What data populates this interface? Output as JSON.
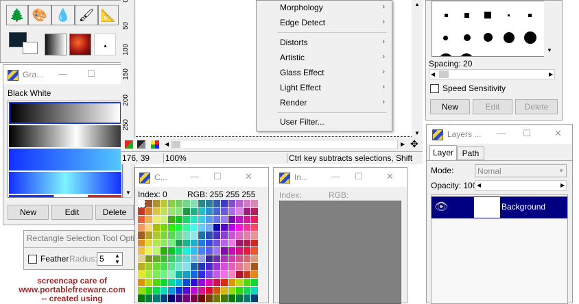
{
  "tools": {
    "icons": [
      "tree-icon",
      "palette-icon",
      "drop-icon",
      "airbrush-icon",
      "compass-icon"
    ]
  },
  "gradient_panel": {
    "title": "Gra...",
    "selected_name": "Black White",
    "buttons": {
      "new": "New",
      "edit": "Edit",
      "delete": "Delete"
    }
  },
  "canvas": {
    "ruler_labels": [
      "0",
      "50",
      "100",
      "150",
      "200",
      "250"
    ],
    "status_coords": "176, 39",
    "status_zoom": "100%",
    "status_hint": "Ctrl key subtracts selections, Shift"
  },
  "menu": {
    "items": [
      {
        "label": "Morphology",
        "submenu": true
      },
      {
        "label": "Edge Detect",
        "submenu": true
      },
      {
        "label": "Distorts",
        "submenu": true
      },
      {
        "label": "Artistic",
        "submenu": true
      },
      {
        "label": "Glass Effect",
        "submenu": true
      },
      {
        "label": "Light Effect",
        "submenu": true
      },
      {
        "label": "Render",
        "submenu": true
      },
      {
        "label": "User Filter...",
        "submenu": false
      }
    ]
  },
  "brush_panel": {
    "spacing_label": "Spacing: 20",
    "speed_sensitivity": "Speed Sensitivity",
    "buttons": {
      "new": "New",
      "edit": "Edit",
      "delete": "Delete"
    }
  },
  "colors_panel": {
    "title": "C...",
    "index_label": "Index: 0",
    "rgb_label": "RGB: 255 255 255"
  },
  "info_panel": {
    "title": "In...",
    "index_label": "Index:",
    "rgb_label": "RGB:"
  },
  "rect_options": {
    "title": "Rectangle Selection Tool Opti",
    "feather_label": "Feather",
    "radius_label": "Radius:",
    "radius_value": "5"
  },
  "layers_panel": {
    "title": "Layers ...",
    "tabs": [
      "Layer",
      "Path"
    ],
    "mode_label": "Mode:",
    "mode_value": "Nomal",
    "opacity_label": "Opacity: 100",
    "layer_name": "Background"
  },
  "watermark": {
    "line1": "screencap care of",
    "line2": "www.portablefreeware.com",
    "line3": "-- created using"
  },
  "colors": {
    "accent": "#000080",
    "watermark": "#a0292b"
  }
}
